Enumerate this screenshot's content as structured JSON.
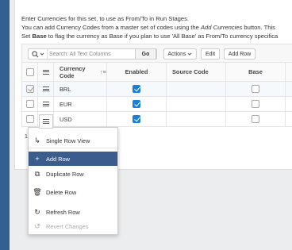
{
  "intro": {
    "line1": "Enter Currencies for this set, to use as From/To in Run Stages.",
    "line2_pre": "You can add Currency Codes from a master set of codes using the ",
    "line2_em": "Add Currencies",
    "line2_post": " button. This",
    "line3_pre": "Set ",
    "line3_bold": "Base",
    "line3_post": " to flag the currency as Base if you plan to use 'All Base' as From/To currency specifica"
  },
  "toolbar": {
    "search_placeholder": "Search: All Text Columns",
    "go_label": "Go",
    "actions_label": "Actions",
    "edit_label": "Edit",
    "add_row_label": "Add Row"
  },
  "grid": {
    "columns": [
      "Currency Code",
      "Enabled",
      "Source Code",
      "Base"
    ],
    "sort_indicator": "↑≡",
    "rows": [
      {
        "code": "BRL",
        "enabled": true,
        "source": "",
        "base": false,
        "selected": true
      },
      {
        "code": "EUR",
        "enabled": true,
        "source": "",
        "base": false,
        "selected": false
      },
      {
        "code": "USD",
        "enabled": true,
        "source": "",
        "base": false,
        "selected": false
      }
    ],
    "footer": "1 ro"
  },
  "row_menu": {
    "items": [
      {
        "label": "Single Row View",
        "icon": "single-row-view-icon",
        "glyph": "↳",
        "state": "normal"
      },
      {
        "label": "Add Row",
        "icon": "plus-icon",
        "glyph": "+",
        "state": "active"
      },
      {
        "label": "Duplicate Row",
        "icon": "duplicate-icon",
        "glyph": "⧉",
        "state": "normal"
      },
      {
        "label": "Delete Row",
        "icon": "trash-icon",
        "glyph": "🗑",
        "state": "normal"
      },
      {
        "label": "Refresh Row",
        "icon": "refresh-icon",
        "glyph": "↻",
        "state": "normal"
      },
      {
        "label": "Revert Changes",
        "icon": "revert-icon",
        "glyph": "↺",
        "state": "disabled"
      }
    ]
  },
  "colors": {
    "rail": "#345f92",
    "menu_active": "#3d5c8e",
    "checkbox_on": "#1a7fd9"
  }
}
